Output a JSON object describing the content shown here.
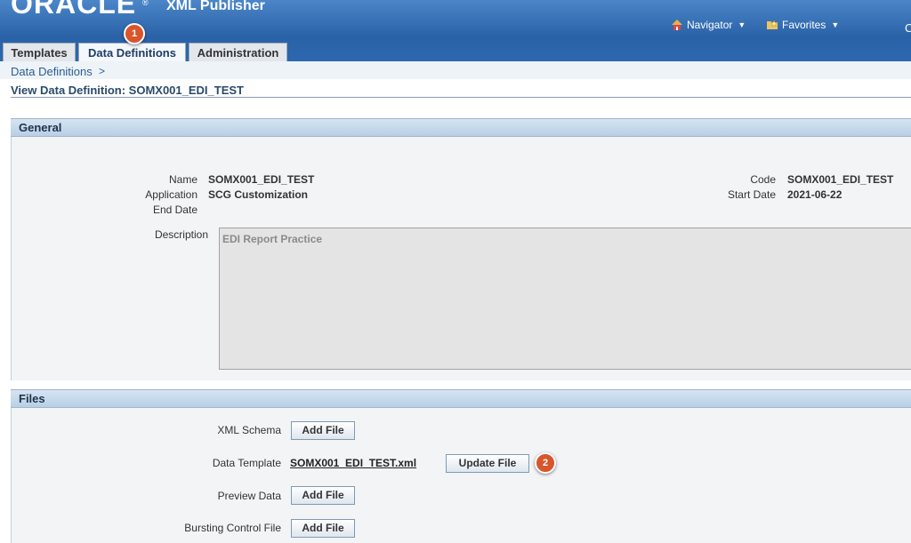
{
  "header": {
    "logo": "ORACLE",
    "logo_reg": "®",
    "app_title": "XML Publisher",
    "navigator_label": "Navigator",
    "favorites_label": "Favorites",
    "cut_text": "C"
  },
  "tabs": [
    {
      "label": "Templates",
      "active": false
    },
    {
      "label": "Data Definitions",
      "active": true
    },
    {
      "label": "Administration",
      "active": false
    }
  ],
  "callouts": {
    "one": "1",
    "two": "2"
  },
  "breadcrumb": {
    "item": "Data Definitions",
    "separator": ">"
  },
  "page_title": "View Data Definition: SOMX001_EDI_TEST",
  "general": {
    "section_title": "General",
    "name_label": "Name",
    "name_value": "SOMX001_EDI_TEST",
    "application_label": "Application",
    "application_value": "SCG Customization",
    "end_date_label": "End Date",
    "code_label": "Code",
    "code_value": "SOMX001_EDI_TEST",
    "start_date_label": "Start Date",
    "start_date_value": "2021-06-22",
    "description_label": "Description",
    "description_value": "EDI Report Practice"
  },
  "files": {
    "section_title": "Files",
    "xml_schema_label": "XML Schema",
    "data_template_label": "Data Template",
    "data_template_file": "SOMX001_EDI_TEST.xml",
    "preview_data_label": "Preview Data",
    "bursting_label": "Bursting Control File",
    "add_file_label": "Add File",
    "update_file_label": "Update File"
  },
  "colors": {
    "header_blue": "#2a62a8",
    "badge": "#d9552c",
    "section_header": "#c7d9ec",
    "link": "#2a5d92"
  }
}
